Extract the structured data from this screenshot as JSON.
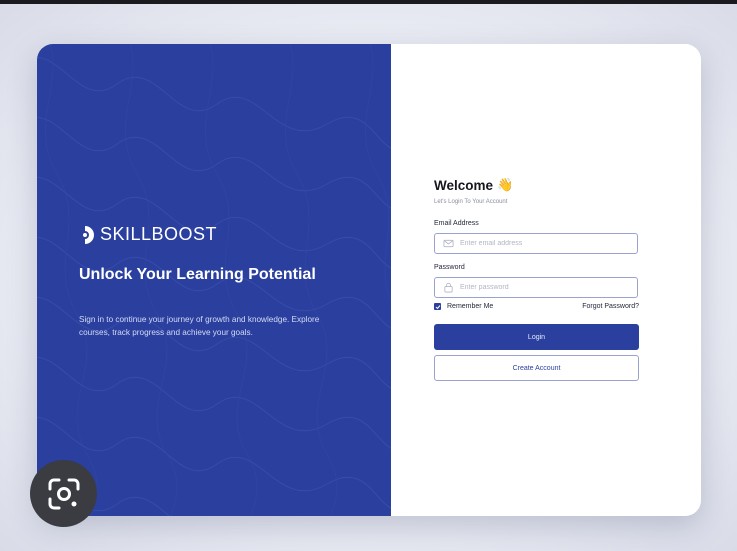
{
  "brand": {
    "name": "SKILLBOOST",
    "logo_icon": "skillboost-logo-icon"
  },
  "hero": {
    "headline": "Unlock Your Learning Potential",
    "subtext": "Sign in to continue your journey of growth and knowledge. Explore courses, track progress and achieve your goals."
  },
  "login": {
    "title": "Welcome",
    "title_emoji": "👋",
    "subtitle": "Let's Login To Your Account",
    "email_label": "Email Address",
    "email_placeholder": "Enter email address",
    "email_value": "",
    "password_label": "Password",
    "password_placeholder": "Enter password",
    "password_value": "",
    "remember_label": "Remember Me",
    "remember_checked": true,
    "forgot_label": "Forgot Password?",
    "login_label": "Login",
    "create_label": "Create Account"
  },
  "overlay": {
    "icon": "google-lens-icon"
  },
  "colors": {
    "brand_blue": "#2a3f9e",
    "panel_white": "#ffffff",
    "input_border": "#9aa3cf"
  }
}
